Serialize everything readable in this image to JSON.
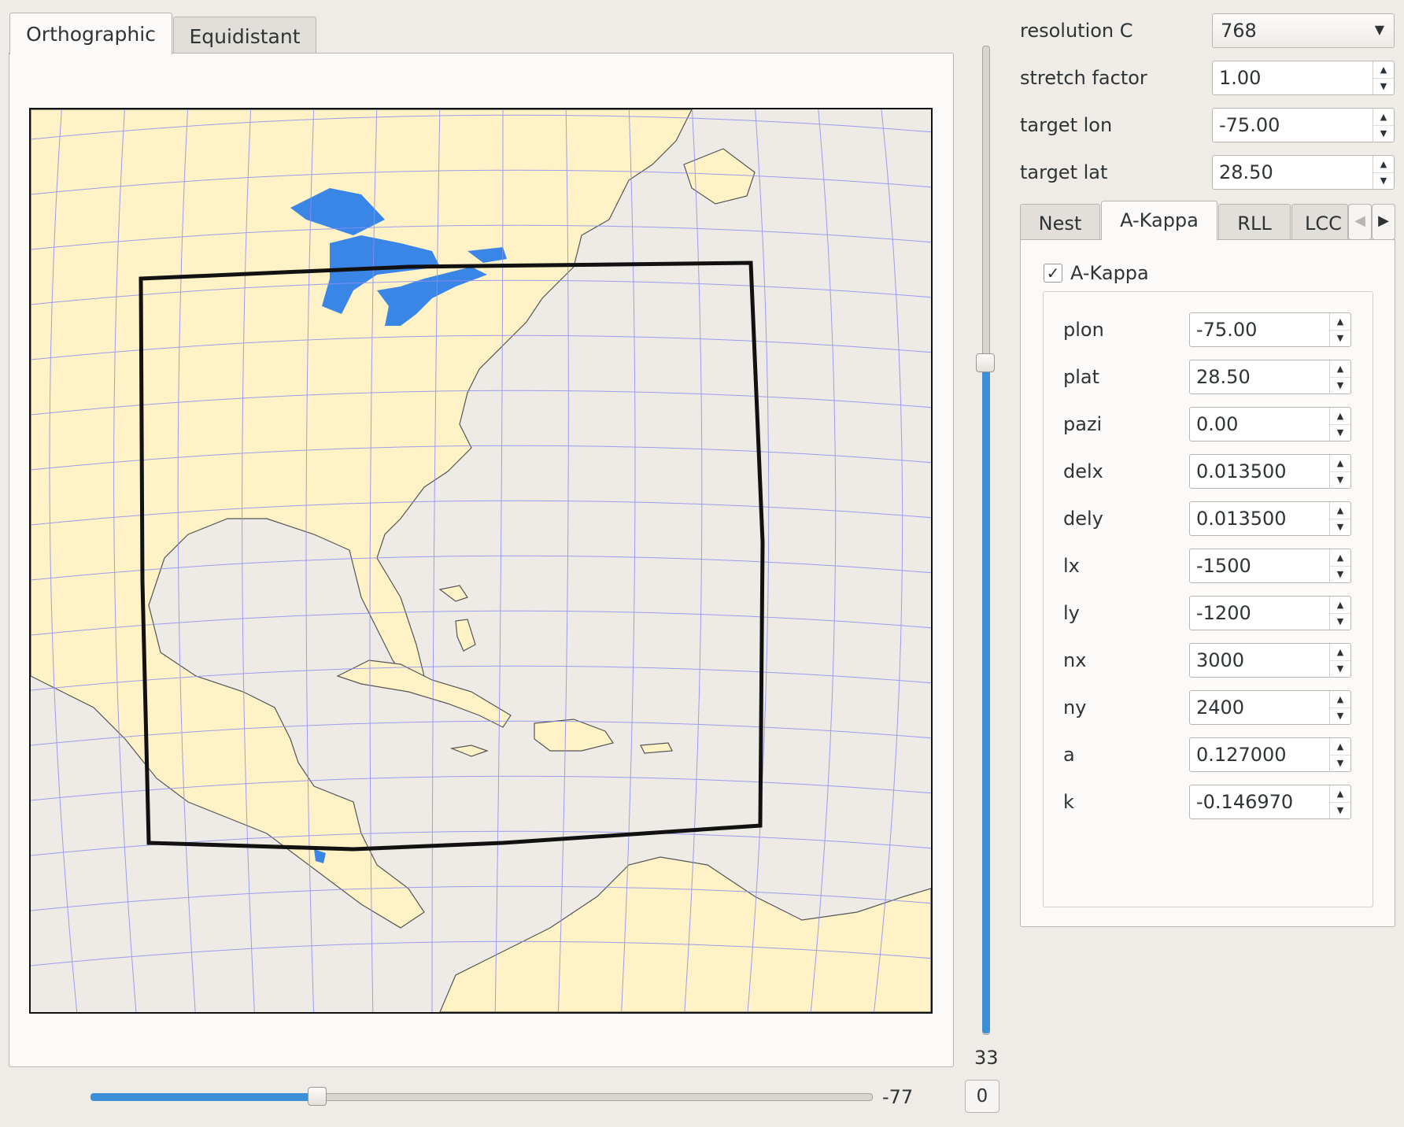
{
  "tabs": {
    "orthographic": "Orthographic",
    "equidistant": "Equidistant"
  },
  "map": {
    "land_color": "#fff2c7",
    "ocean_color": "#eeebe6",
    "lake_color": "#3a86e6",
    "grid_color": "#8e8ef0",
    "domain_color": "#111111"
  },
  "vertical_slider": {
    "value": 33,
    "fill_fraction": 0.68
  },
  "horizontal_slider": {
    "value": -77,
    "fill_fraction": 0.29
  },
  "reset_button": "0",
  "global_params": {
    "resolution": {
      "label": "resolution C",
      "value": "768"
    },
    "stretch": {
      "label": "stretch factor",
      "value": "1.00"
    },
    "target_lon": {
      "label": "target lon",
      "value": "-75.00"
    },
    "target_lat": {
      "label": "target lat",
      "value": "28.50"
    }
  },
  "subtabs": {
    "nest": "Nest",
    "akappa": "A-Kappa",
    "rll": "RLL",
    "lcc": "LCC"
  },
  "akappa": {
    "checkbox_label": "A-Kappa",
    "checked": true,
    "fields": [
      {
        "label": "plon",
        "value": "-75.00"
      },
      {
        "label": "plat",
        "value": "28.50"
      },
      {
        "label": "pazi",
        "value": "0.00"
      },
      {
        "label": "delx",
        "value": "0.013500"
      },
      {
        "label": "dely",
        "value": "0.013500"
      },
      {
        "label": "lx",
        "value": "-1500"
      },
      {
        "label": "ly",
        "value": "-1200"
      },
      {
        "label": "nx",
        "value": "3000"
      },
      {
        "label": "ny",
        "value": "2400"
      },
      {
        "label": "a",
        "value": "0.127000"
      },
      {
        "label": "k",
        "value": "-0.146970"
      }
    ]
  }
}
